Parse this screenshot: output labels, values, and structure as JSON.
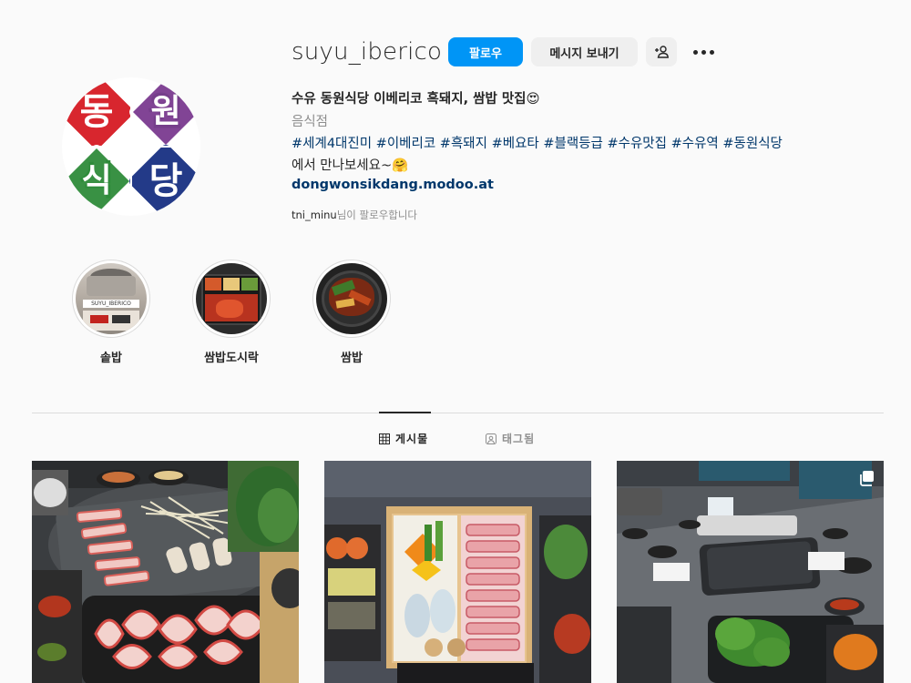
{
  "profile": {
    "username": "suyu_iberico",
    "avatar_chars": [
      "동",
      "원",
      "식",
      "당"
    ],
    "follow_label": "팔로우",
    "message_label": "메시지 보내기",
    "display_name": "수유 동원식당 이베리코 흑돼지, 쌈밥 맛집😍",
    "category": "음식점",
    "bio_tags": "#세계4대진미 #이베리코 #흑돼지 #베요타 #블랙등급 #수유맛집 #수유역 #동원식당",
    "bio_line2": "에서 만나보세요~🤗",
    "website": "dongwonsikdang.modoo.at",
    "followed_by_user": "tni_minu",
    "followed_by_suffix": "님이 팔로우합니다"
  },
  "highlights": [
    {
      "label": "솥밥",
      "sign_text": "SUYU_IBERICO"
    },
    {
      "label": "쌈밥도시락"
    },
    {
      "label": "쌈밥"
    }
  ],
  "tabs": [
    {
      "label": "게시물",
      "active": true
    },
    {
      "label": "태그됨",
      "active": false
    }
  ],
  "colors": {
    "follow_button": "#0095f6",
    "link": "#00376b",
    "avatar_red": "#d8262e",
    "avatar_green": "#2e8b3a",
    "avatar_purple": "#7a3a8f",
    "avatar_navy": "#233a88"
  },
  "icons": {
    "suggest": "person-plus-icon",
    "more": "more-options-icon",
    "posts_tab": "grid-icon",
    "tagged_tab": "tag-icon",
    "multi_post": "carousel-icon"
  }
}
